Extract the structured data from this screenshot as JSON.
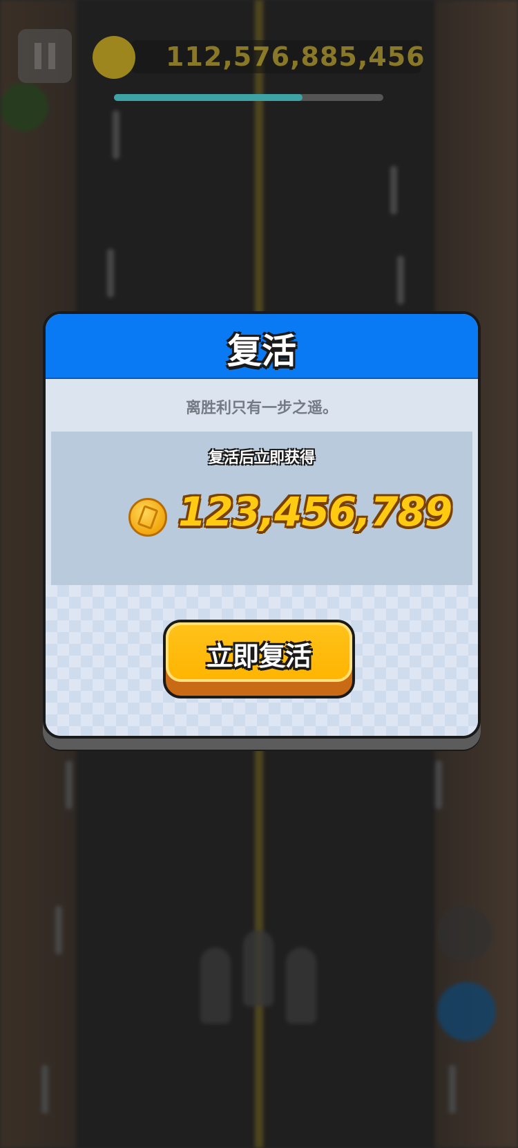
{
  "hud": {
    "score": "112,576,885,456",
    "progress": 0.7
  },
  "dialog": {
    "title": "复活",
    "subtitle": "离胜利只有一步之遥。",
    "reward_label": "复活后立即获得",
    "reward_amount": "123,456,789",
    "revive_button_label": "立即复活"
  },
  "colors": {
    "header_blue": "#0a7af4",
    "button_yellow": "#ffb400",
    "coin_gold": "#ffca12"
  }
}
